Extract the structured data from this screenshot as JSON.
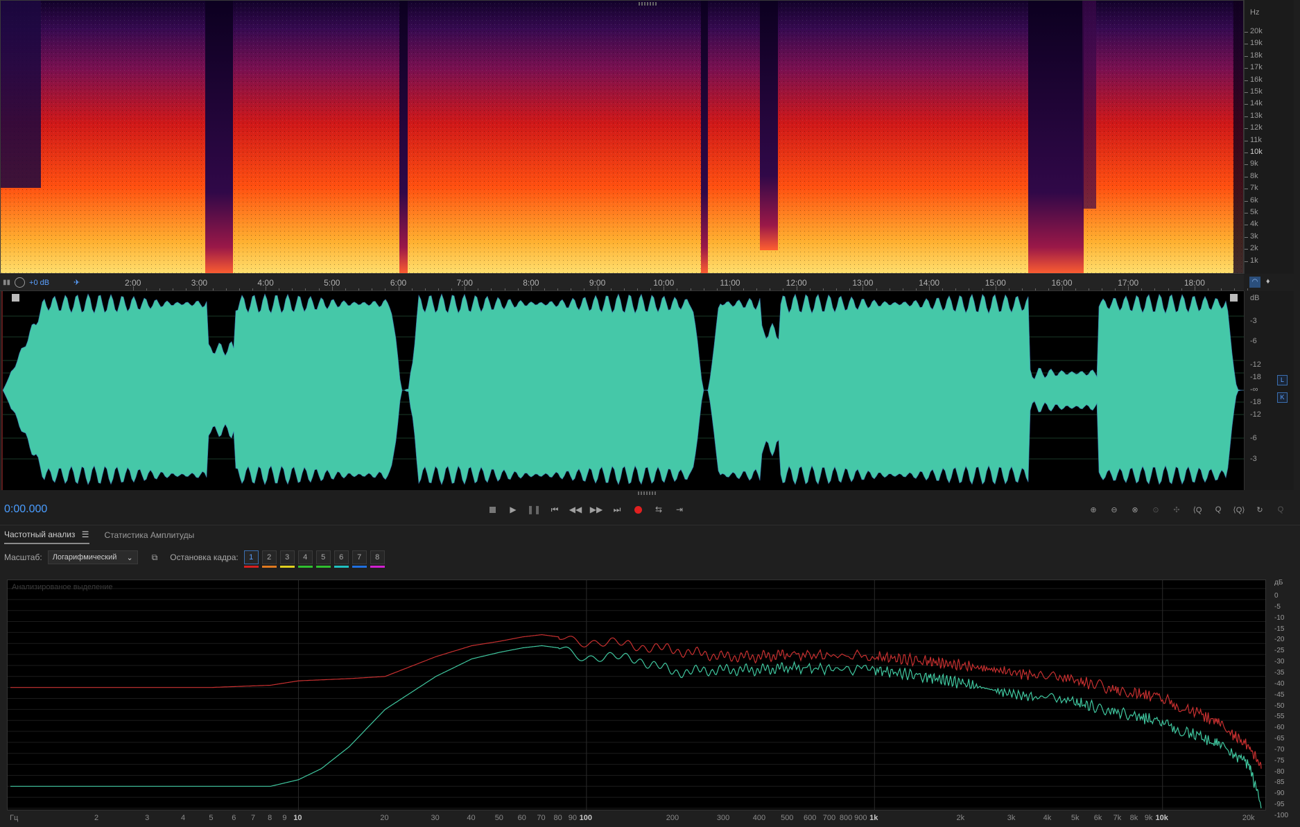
{
  "spectrogram": {
    "unit": "Hz",
    "freq_labels": [
      "20k",
      "19k",
      "18k",
      "17k",
      "16k",
      "15k",
      "14k",
      "13k",
      "12k",
      "11k",
      "10k",
      "9k",
      "8k",
      "7k",
      "6k",
      "5k",
      "4k",
      "3k",
      "2k",
      "1k"
    ]
  },
  "timeline": {
    "gain": "+0 dB",
    "labels": [
      "2:00",
      "3:00",
      "4:00",
      "5:00",
      "6:00",
      "7:00",
      "8:00",
      "9:00",
      "10:00",
      "11:00",
      "12:00",
      "13:00",
      "14:00",
      "15:00",
      "16:00",
      "17:00",
      "18:00"
    ]
  },
  "waveform": {
    "unit": "dB",
    "db_labels": [
      "-3",
      "-6",
      "-12",
      "-18",
      "-∞",
      "-18",
      "-12",
      "-6",
      "-3"
    ],
    "channels": [
      "L",
      "K"
    ],
    "color": "#45c8a8"
  },
  "transport": {
    "time": "0:00.000"
  },
  "panel": {
    "tabs": [
      "Частотный анализ",
      "Статистика Амплитуды"
    ],
    "scale_label": "Масштаб:",
    "scale_value": "Логарифмический",
    "freeze_label": "Остановка кадра:",
    "frames": [
      "1",
      "2",
      "3",
      "4",
      "5",
      "6",
      "7",
      "8"
    ],
    "frame_colors": [
      "#d62020",
      "#e07a20",
      "#e0d020",
      "#30c030",
      "#30c030",
      "#20c0c0",
      "#2070e0",
      "#d020d0"
    ],
    "plot_caption": "Анализированое выделение"
  },
  "chart_data": {
    "type": "line",
    "xscale": "log",
    "xlabel": "Гц",
    "ylabel": "дБ",
    "xlim": [
      1,
      22000
    ],
    "ylim": [
      -100,
      0
    ],
    "x_tick_labels": [
      "2",
      "3",
      "4",
      "5",
      "6",
      "7",
      "8",
      "9",
      "10",
      "20",
      "30",
      "40",
      "50",
      "60",
      "70",
      "80",
      "90",
      "100",
      "200",
      "300",
      "400",
      "500",
      "600",
      "700",
      "800",
      "900",
      "1k",
      "2k",
      "3k",
      "4k",
      "5k",
      "6k",
      "7k",
      "8k",
      "9k",
      "10k",
      "20k"
    ],
    "y_tick_labels": [
      "0",
      "-5",
      "-10",
      "-15",
      "-20",
      "-25",
      "-30",
      "-35",
      "-40",
      "-45",
      "-50",
      "-55",
      "-60",
      "-65",
      "-70",
      "-75",
      "-80",
      "-85",
      "-90",
      "-95",
      "-100"
    ],
    "series": [
      {
        "color": "#c83030",
        "x": [
          1,
          5,
          8,
          10,
          15,
          20,
          30,
          40,
          50,
          60,
          70,
          80,
          100,
          150,
          200,
          300,
          400,
          500,
          1000,
          1500,
          2000,
          3000,
          5000,
          7000,
          10000,
          15000,
          20000,
          22000
        ],
        "y": [
          -45,
          -45,
          -44,
          -42,
          -41,
          -40,
          -31,
          -26,
          -24,
          -22,
          -21,
          -22,
          -24,
          -26,
          -28,
          -31,
          -31,
          -30,
          -31,
          -33,
          -35,
          -38,
          -42,
          -46,
          -50,
          -60,
          -72,
          -82
        ]
      },
      {
        "color": "#40c8a0",
        "x": [
          1,
          5,
          8,
          10,
          12,
          15,
          20,
          30,
          40,
          50,
          60,
          70,
          80,
          100,
          150,
          200,
          300,
          400,
          500,
          1000,
          1500,
          2000,
          3000,
          5000,
          7000,
          10000,
          15000,
          20000,
          22000
        ],
        "y": [
          -90,
          -90,
          -90,
          -87,
          -82,
          -72,
          -55,
          -40,
          -32,
          -29,
          -27,
          -26,
          -27,
          -31,
          -32,
          -38,
          -37,
          -37,
          -36,
          -37,
          -40,
          -43,
          -48,
          -52,
          -56,
          -61,
          -70,
          -80,
          -100
        ]
      }
    ]
  }
}
